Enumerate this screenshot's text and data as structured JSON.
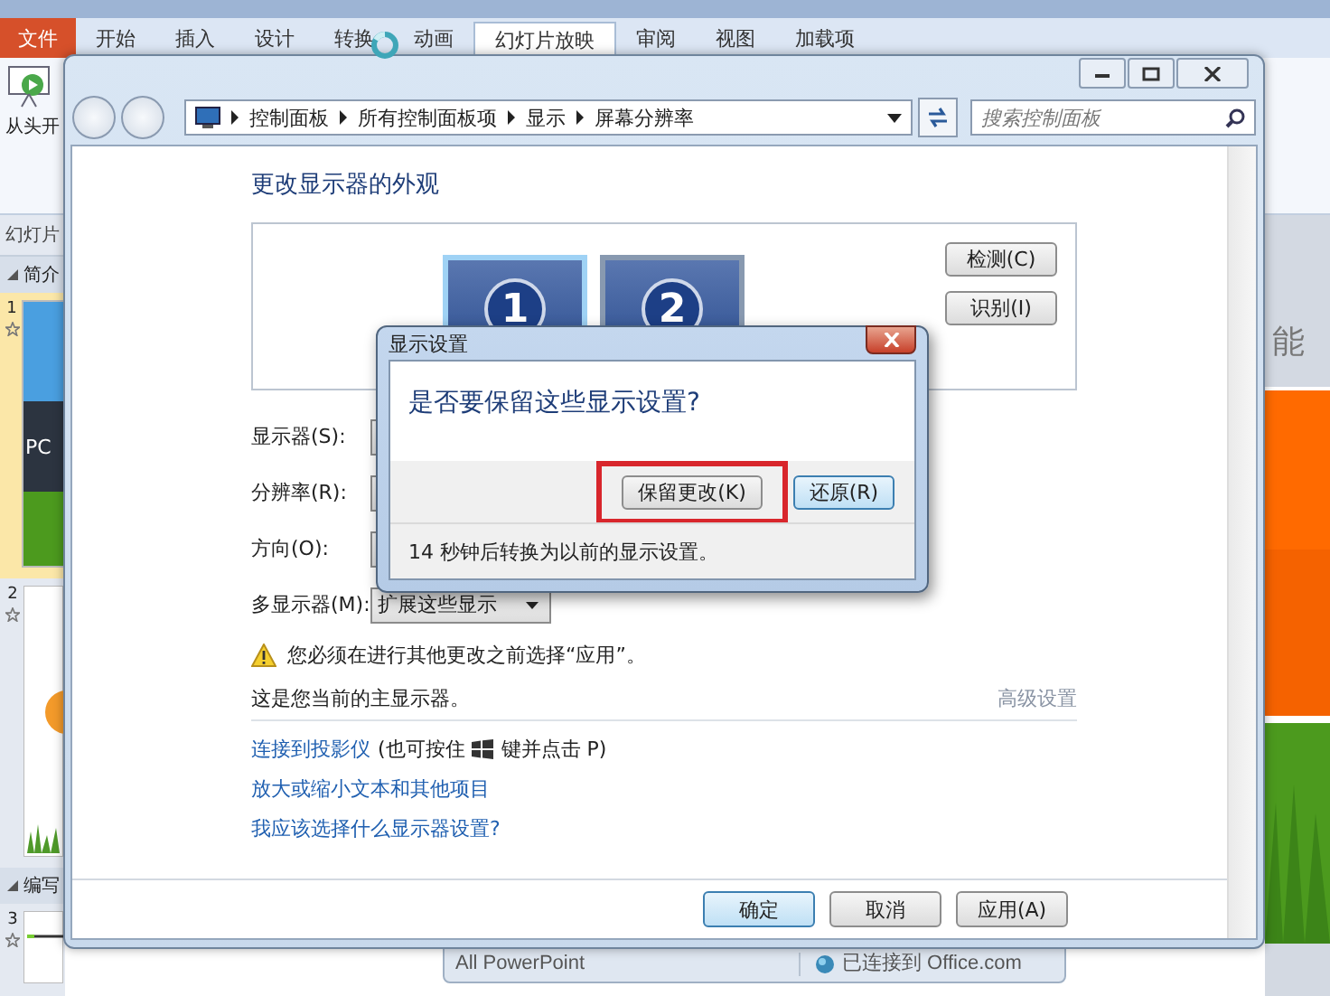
{
  "powerpoint": {
    "file_tab": "文件",
    "tabs": [
      {
        "label": "开始",
        "selected": false
      },
      {
        "label": "插入",
        "selected": false
      },
      {
        "label": "设计",
        "selected": false
      },
      {
        "label": "转换",
        "selected": false
      },
      {
        "label": "动画",
        "selected": false
      },
      {
        "label": "幻灯片放映",
        "selected": true
      },
      {
        "label": "审阅",
        "selected": false
      },
      {
        "label": "视图",
        "selected": false
      },
      {
        "label": "加载项",
        "selected": false
      }
    ],
    "ribbon_button": "从头开",
    "panel_tab": "幻灯片",
    "sections": [
      {
        "title": "简介",
        "slides": [
          {
            "number": "1",
            "kind": "title",
            "text": "PC"
          },
          {
            "number": "2",
            "kind": "sun"
          }
        ]
      },
      {
        "title": "编写",
        "slides": [
          {
            "number": "3",
            "kind": "line"
          }
        ]
      }
    ],
    "slide_text": "能",
    "status_bar": [
      "All PowerPoint",
      "已连接到 Office.com"
    ]
  },
  "control_panel": {
    "path": [
      "控制面板",
      "所有控制面板项",
      "显示",
      "屏幕分辨率"
    ],
    "search": {
      "placeholder": "搜索控制面板"
    },
    "heading": "更改显示器的外观",
    "monitors": [
      {
        "label": "1",
        "selected": true
      },
      {
        "label": "2",
        "selected": false
      }
    ],
    "side_buttons": [
      "检测(C)",
      "识别(I)"
    ],
    "fields": [
      {
        "label": "显示器(S):"
      },
      {
        "label": "分辨率(R):"
      },
      {
        "label": "方向(O):"
      },
      {
        "label": "多显示器(M):",
        "value": "扩展这些显示"
      }
    ],
    "warning": "您必须在进行其他更改之前选择“应用”。",
    "main_display_note": "这是您当前的主显示器。",
    "advanced_link": "高级设置",
    "projector_link": {
      "text": "连接到投影仪",
      "before_key": "(也可按住",
      "after_key": "键并点击 P)"
    },
    "links": [
      "放大或缩小文本和其他项目",
      "我应该选择什么显示器设置?"
    ],
    "buttons": [
      {
        "label": "确定",
        "default": true
      },
      {
        "label": "取消",
        "default": false
      },
      {
        "label": "应用(A)",
        "default": false
      }
    ]
  },
  "dialog": {
    "title": "显示设置",
    "question": "是否要保留这些显示设置?",
    "buttons": [
      {
        "label": "保留更改(K)",
        "highlighted": true,
        "focused": false
      },
      {
        "label": "还原(R)",
        "highlighted": false,
        "focused": true
      }
    ],
    "countdown": "14 秒钟后转换为以前的显示设置。"
  }
}
